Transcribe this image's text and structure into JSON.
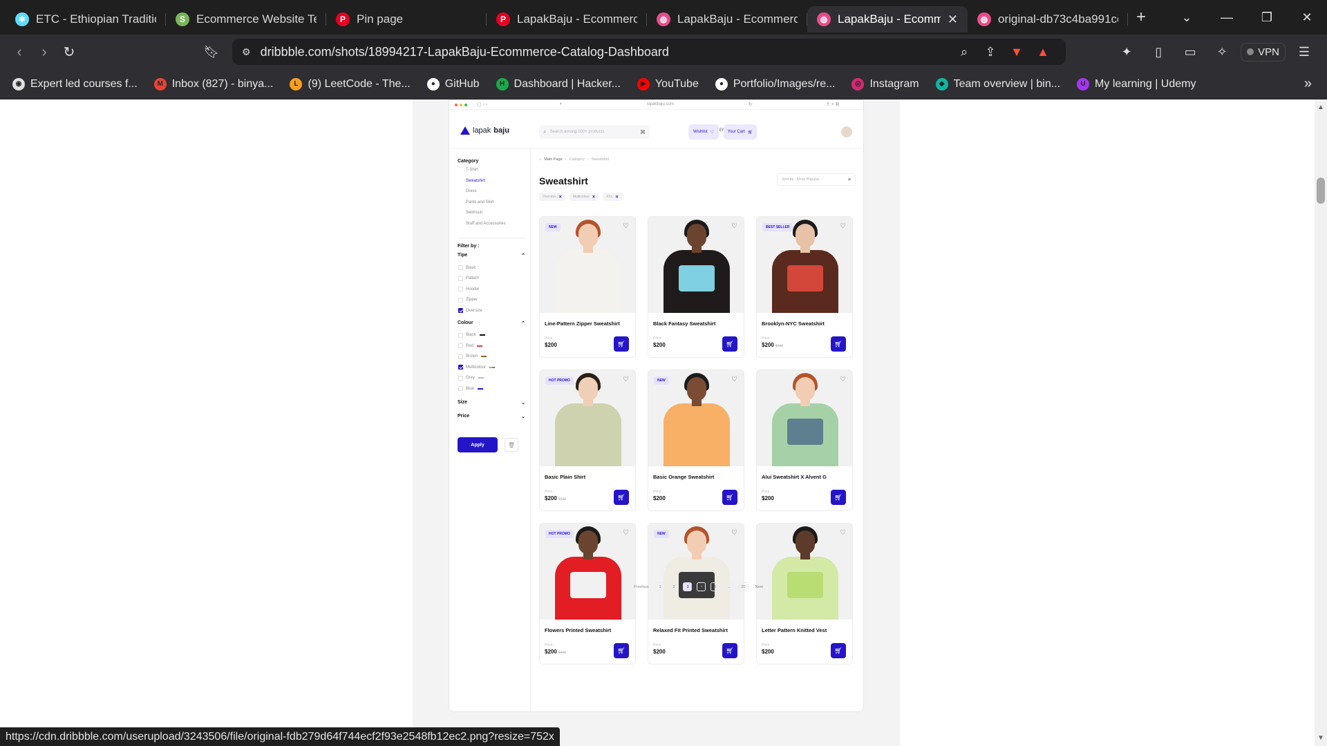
{
  "tabs": [
    {
      "title": "ETC - Ethiopian Traditiona",
      "favicon": "react-icon",
      "color": "#61dafb"
    },
    {
      "title": "Ecommerce Website Temp",
      "favicon": "shopify-icon",
      "color": "#7ab55c"
    },
    {
      "title": "Pin page",
      "favicon": "pinterest-icon",
      "color": "#e60023"
    },
    {
      "title": "LapakBaju - Ecommerce C",
      "favicon": "pinterest-icon",
      "color": "#e60023"
    },
    {
      "title": "LapakBaju - Ecommerce C",
      "favicon": "dribbble-icon",
      "color": "#ea4c89"
    },
    {
      "title": "LapakBaju - Ecomme",
      "favicon": "dribbble-icon",
      "color": "#ea4c89",
      "active": true
    },
    {
      "title": "original-db73c4ba991ce0",
      "favicon": "dribbble-icon",
      "color": "#ea4c89"
    }
  ],
  "toolbar": {
    "url": "dribbble.com/shots/18994217-LapakBaju-Ecommerce-Catalog-Dashboard",
    "vpn_label": "VPN",
    "brave_badge": "1",
    "alert_badge": "1"
  },
  "bookmarks": [
    {
      "label": "Expert led courses f...",
      "icon": "pluralsight-icon",
      "color": "#e0e0e0"
    },
    {
      "label": "Inbox (827) - binya...",
      "icon": "gmail-icon",
      "color": "#ea4335"
    },
    {
      "label": "(9) LeetCode - The...",
      "icon": "leetcode-icon",
      "color": "#f89f1b"
    },
    {
      "label": "GitHub",
      "icon": "github-icon",
      "color": "#ffffff"
    },
    {
      "label": "Dashboard | Hacker...",
      "icon": "hackerrank-icon",
      "color": "#1ba94c"
    },
    {
      "label": "YouTube",
      "icon": "youtube-icon",
      "color": "#ff0000"
    },
    {
      "label": "Portfolio/Images/re...",
      "icon": "github-icon",
      "color": "#ffffff"
    },
    {
      "label": "Instagram",
      "icon": "instagram-icon",
      "color": "#d62976"
    },
    {
      "label": "Team overview | bin...",
      "icon": "team-icon",
      "color": "#0fb5a0"
    },
    {
      "label": "My learning | Udemy",
      "icon": "udemy-icon",
      "color": "#a435f0"
    }
  ],
  "status_url": "https://cdn.dribbble.com/userupload/3243506/file/original-fdb279d64f744ecf2f93e2548fb12ec2.png?resize=752x",
  "mockup": {
    "browser_url": "lapakbaju.com",
    "logo_light": "lapak",
    "logo_bold": "baju",
    "search_placeholder": "Search among 100+ products",
    "language": "ENG",
    "wishlist_label": "Wishlist",
    "cart_label": "Your Cart",
    "accent": "#2415c9",
    "sidebar": {
      "category_title": "Category",
      "categories": [
        {
          "label": "T-Shirt",
          "active": false
        },
        {
          "label": "Sweatshirt",
          "active": true
        },
        {
          "label": "Dress",
          "active": false
        },
        {
          "label": "Pants and Skirt",
          "active": false
        },
        {
          "label": "Swimsuit",
          "active": false
        },
        {
          "label": "Stuff and Accessories",
          "active": false
        }
      ],
      "filter_title": "Filter by :",
      "type_title": "Tipe",
      "types": [
        {
          "label": "Basic",
          "checked": false
        },
        {
          "label": "Pattern",
          "checked": false
        },
        {
          "label": "Hoodie",
          "checked": false
        },
        {
          "label": "Zipper",
          "checked": false
        },
        {
          "label": "Oversize",
          "checked": true
        }
      ],
      "colour_title": "Colour",
      "colours": [
        {
          "label": "Black",
          "checked": false,
          "swatch": "#111111"
        },
        {
          "label": "Red",
          "checked": false,
          "swatch": "#e53935"
        },
        {
          "label": "Brown",
          "checked": false,
          "swatch": "#8d5a2b"
        },
        {
          "label": "Multicolour",
          "checked": true,
          "swatch": "multi"
        },
        {
          "label": "Grey",
          "checked": false,
          "swatch": "#bdbdbd"
        },
        {
          "label": "Blue",
          "checked": false,
          "swatch": "#2415c9"
        }
      ],
      "size_title": "Size",
      "price_title": "Price",
      "apply_label": "Apply"
    },
    "breadcrumb": [
      "Main Page",
      "Category",
      "Sweatshirt"
    ],
    "page_title": "Sweatshirt",
    "sort_label": "Sort by : Most Popular",
    "chips": [
      "Oversize",
      "Multicolour",
      "XXL"
    ],
    "price_label": "Price :",
    "products": [
      {
        "name": "Line-Pattern Zipper Sweatshirt",
        "price": "$200",
        "old": "",
        "badge": "NEW",
        "hair": "#b5532a",
        "skin": "#f2cdb3",
        "shirt": "#f4f2ee",
        "print": "#f4f2ee"
      },
      {
        "name": "Black Fantasy Sweatshirt",
        "price": "$200",
        "old": "",
        "badge": "",
        "hair": "#1b1b1b",
        "skin": "#6b4430",
        "shirt": "#1f1b1b",
        "print": "#7fd0e0"
      },
      {
        "name": "Brooklyn-NYC Sweatshirt",
        "price": "$200",
        "old": "$420",
        "badge": "BEST SELLER",
        "hair": "#1b1b1b",
        "skin": "#e8c2a6",
        "shirt": "#5a2a1e",
        "print": "#d2473a"
      },
      {
        "name": "Basic Plain Shirt",
        "price": "$200",
        "old": "$420",
        "badge": "HOT PROMO",
        "hair": "#2a1e18",
        "skin": "#efcfb7",
        "shirt": "#cfd2ae",
        "print": "#cfd2ae"
      },
      {
        "name": "Basic Orange Sweatshirt",
        "price": "$200",
        "old": "",
        "badge": "NEW",
        "hair": "#1b1b1b",
        "skin": "#7a4c34",
        "shirt": "#f8b067",
        "print": "#f8b067"
      },
      {
        "name": "Alui Sweatshirt X Alvent G",
        "price": "$200",
        "old": "",
        "badge": "",
        "hair": "#b5532a",
        "skin": "#f2cdb3",
        "shirt": "#a6d1a7",
        "print": "#5d7f8f"
      },
      {
        "name": "Flowers Printed Sweatshirt",
        "price": "$200",
        "old": "$420",
        "badge": "HOT PROMO",
        "hair": "#1b1b1b",
        "skin": "#6b4430",
        "shirt": "#e21d23",
        "print": "#f1f1f1"
      },
      {
        "name": "Relaxed Fit Printed Sweatshirt",
        "price": "$200",
        "old": "",
        "badge": "NEW",
        "hair": "#b5532a",
        "skin": "#f2cdb3",
        "shirt": "#efece4",
        "print": "#3a3a3a"
      },
      {
        "name": "Letter Pattern Knitted Vest",
        "price": "$200",
        "old": "",
        "badge": "",
        "hair": "#1b1b1b",
        "skin": "#5c3b2a",
        "shirt": "#d3e9a6",
        "print": "#b9dd73"
      }
    ],
    "pagination": {
      "prev": "Previous",
      "pages": [
        "1",
        "2",
        "3",
        "4",
        "5",
        "...",
        "20"
      ],
      "current": "3",
      "next": "Next"
    }
  }
}
